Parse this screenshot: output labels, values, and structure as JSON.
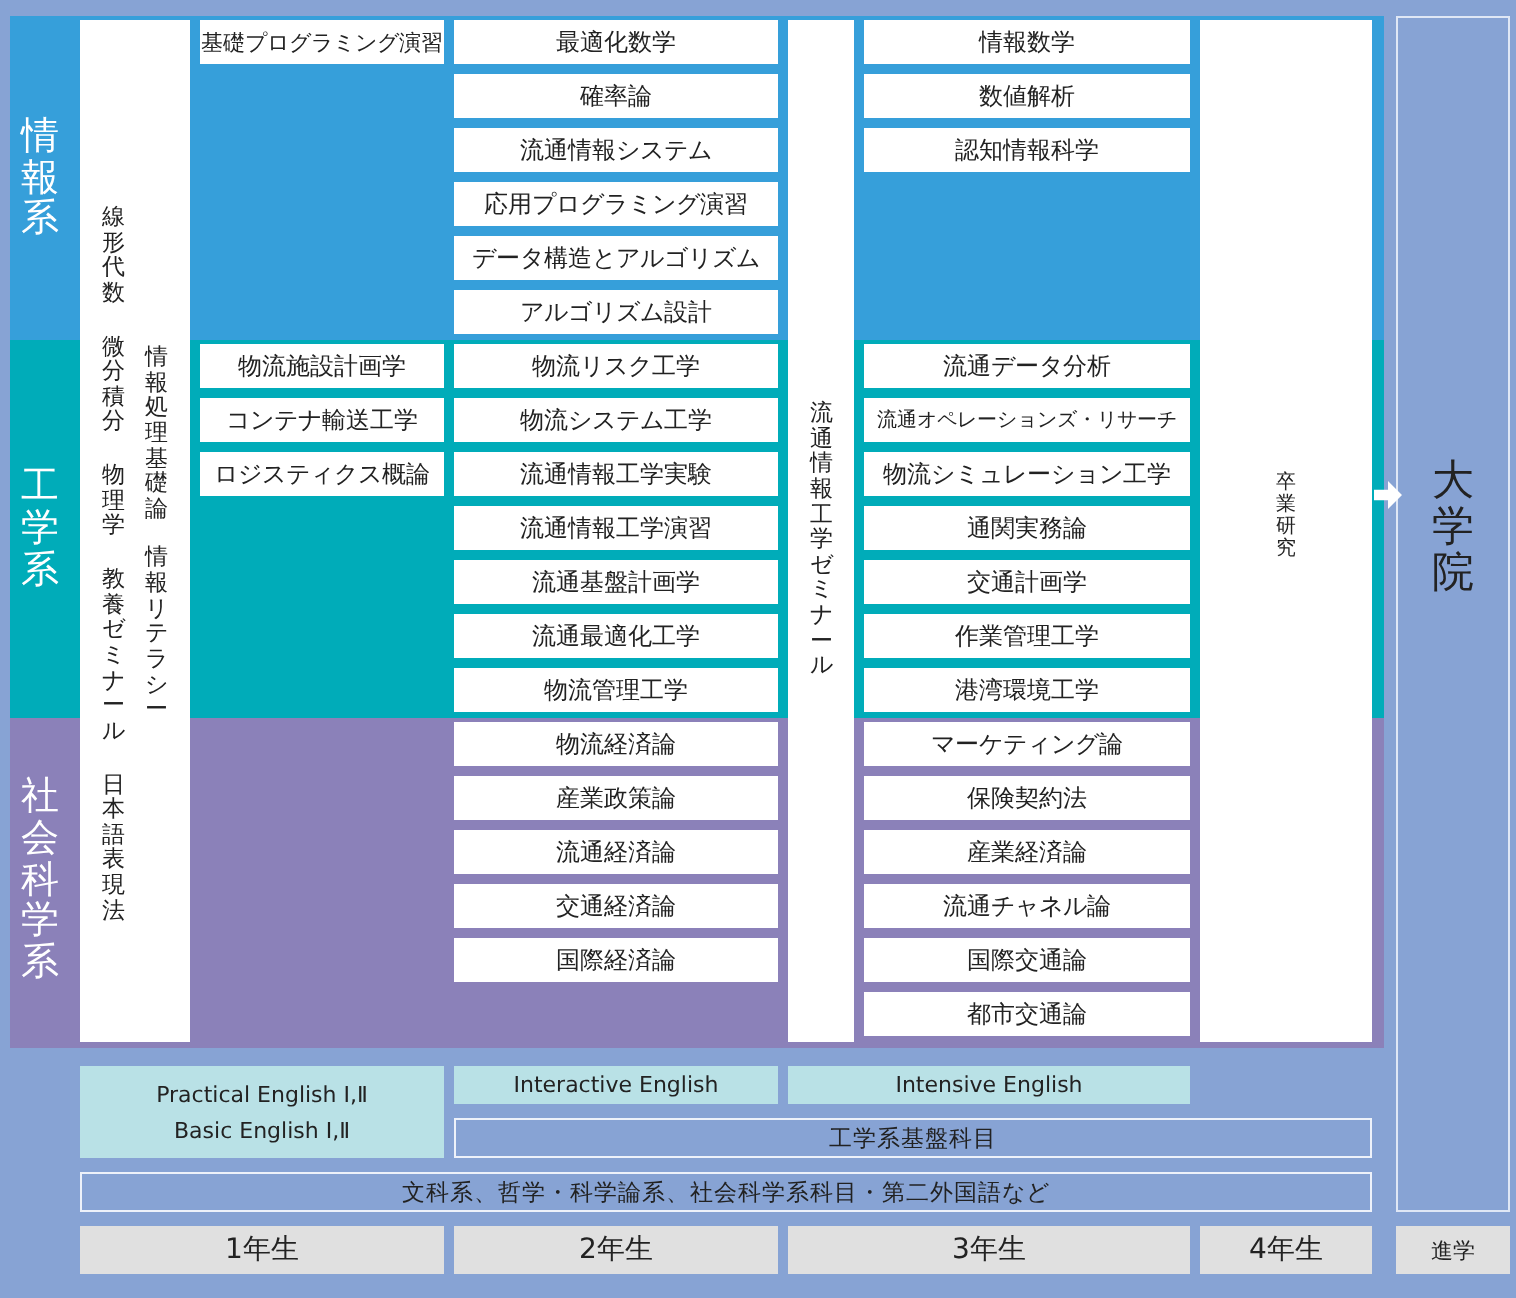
{
  "bands": [
    {
      "label": "情報系",
      "color": "#369fda",
      "year_1": [
        "基礎プログラミング演習"
      ],
      "year_2": [
        "最適化数学",
        "確率論",
        "流通情報システム",
        "応用プログラミング演習",
        "データ構造とアルゴリズム",
        "アルゴリズム設計"
      ],
      "year_3": [
        "情報数学",
        "数値解析",
        "認知情報科学"
      ]
    },
    {
      "label": "工学系",
      "color": "#00acb9",
      "year_1": [
        "物流施設計画学",
        "コンテナ輸送工学",
        "ロジスティクス概論"
      ],
      "year_2": [
        "物流リスク工学",
        "物流システム工学",
        "流通情報工学実験",
        "流通情報工学演習",
        "流通基盤計画学",
        "流通最適化工学",
        "物流管理工学"
      ],
      "year_3": [
        "流通データ分析",
        "流通オペレーションズ・リサーチ",
        "物流シミュレーション工学",
        "通関実務論",
        "交通計画学",
        "作業管理工学",
        "港湾環境工学"
      ]
    },
    {
      "label": "社会科学系",
      "color": "#8b81b9",
      "year_2": [
        "物流経済論",
        "産業政策論",
        "流通経済論",
        "交通経済論",
        "国際経済論"
      ],
      "year_3": [
        "マーケティング論",
        "保険契約法",
        "産業経済論",
        "流通チャネル論",
        "国際交通論",
        "都市交通論"
      ]
    }
  ],
  "foundation_courses": [
    [
      "線形代数",
      "微分積分",
      "物理学",
      "教養ゼミナール",
      "日本語表現法"
    ],
    [
      "情報処理基礎論",
      "情報リテラシー"
    ]
  ],
  "seminar": "流通情報工学ゼミナール",
  "graduation_research": "卒業研究",
  "graduate_school": "大学院",
  "advance_label": "進学",
  "english_courses": {
    "year_1": [
      "Practical English Ⅰ,Ⅱ",
      "Basic English Ⅰ,Ⅱ"
    ],
    "year_2": "Interactive English",
    "year_3": "Intensive English"
  },
  "engineering_basics": "工学系基盤科目",
  "liberal_arts": "文科系、哲学・科学論系、社会科学系科目・第二外国語など",
  "years": [
    "1年生",
    "2年生",
    "3年生",
    "4年生"
  ]
}
